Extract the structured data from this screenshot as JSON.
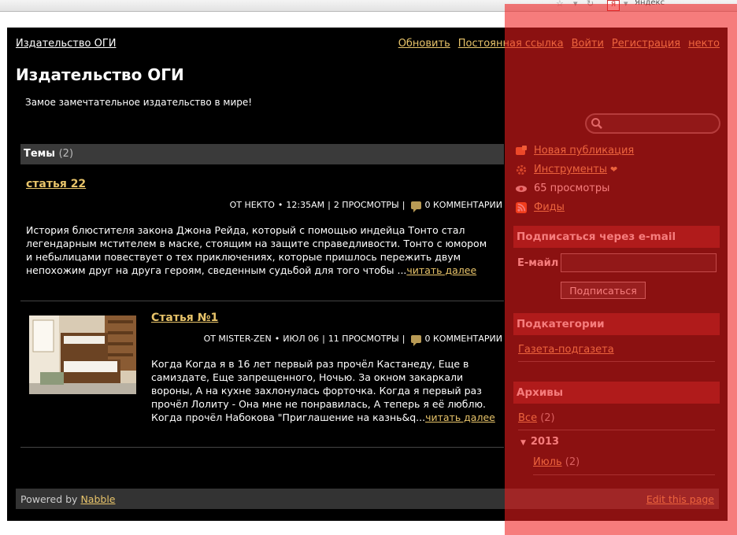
{
  "browser": {
    "search_label": "Яндекс"
  },
  "header": {
    "site_link": "Издательство ОГИ",
    "nav": [
      "Обновить",
      "Постоянная ссылка",
      "Войти",
      "Регистрация",
      "некто"
    ],
    "title": "Издательство ОГИ",
    "tagline": "Замое замечтательное издательство в мире!"
  },
  "search": {
    "placeholder": ""
  },
  "topics": {
    "label": "Темы",
    "count": "(2)",
    "posts": [
      {
        "title": "статья 22",
        "author": "ОТ НЕКТО",
        "time": "12:35AM",
        "views": "2 ПРОСМОТРЫ",
        "comments": "0 КОММЕНТАРИИ",
        "excerpt": "История блюстителя закона Джона Рейда, который с помощью индейца Тонто стал легендарным мстителем в маске, стоящим на защите справедливости. Тонто с юмором и небылицами повествует о тех приключениях, которые пришлось пережить двум непохожим друг на друга героям, сведенным судьбой для того чтобы ...",
        "read_more": "читать далее"
      },
      {
        "title": "Статья №1",
        "author": "ОТ MISTER-ZEN",
        "time": "ИЮЛ 06",
        "views": "11 ПРОСМОТРЫ",
        "comments": "0 КОММЕНТАРИИ",
        "excerpt": "Когда Когда я в 16 лет первый раз прочёл Кастанеду, Еще в самиздате, Еще запрещенного, Ночью. За окном закаркали вороны, А на кухне захлонулась форточка. Когда я первый раз прочёл Лолиту - Она мне не понравилась, А теперь я её люблю. Когда прочёл Набокова \"Приглашение на казнь&q...",
        "read_more": "читать далее"
      }
    ]
  },
  "sidebar": {
    "new_post": "Новая публикация",
    "tools": "Инструменты",
    "views": "65 просмотры",
    "feeds": "Фиды",
    "subscribe_heading": "Подписаться через е-mail",
    "email_label": "Е-майл",
    "subscribe_button": "Подписаться",
    "subcategories_heading": "Подкатегории",
    "subcategory": "Газета-подгазета",
    "archives_heading": "Архивы",
    "archive_all": "Все",
    "archive_all_count": "(2)",
    "archive_year": "2013",
    "archive_month": "Июль",
    "archive_month_count": "(2)"
  },
  "footer": {
    "powered_prefix": "Powered by",
    "powered_link": "Nabble",
    "edit": "Edit this page"
  },
  "colors": {
    "link": "#e8c46a",
    "background": "#000000",
    "highlight": "#f01e1e"
  }
}
